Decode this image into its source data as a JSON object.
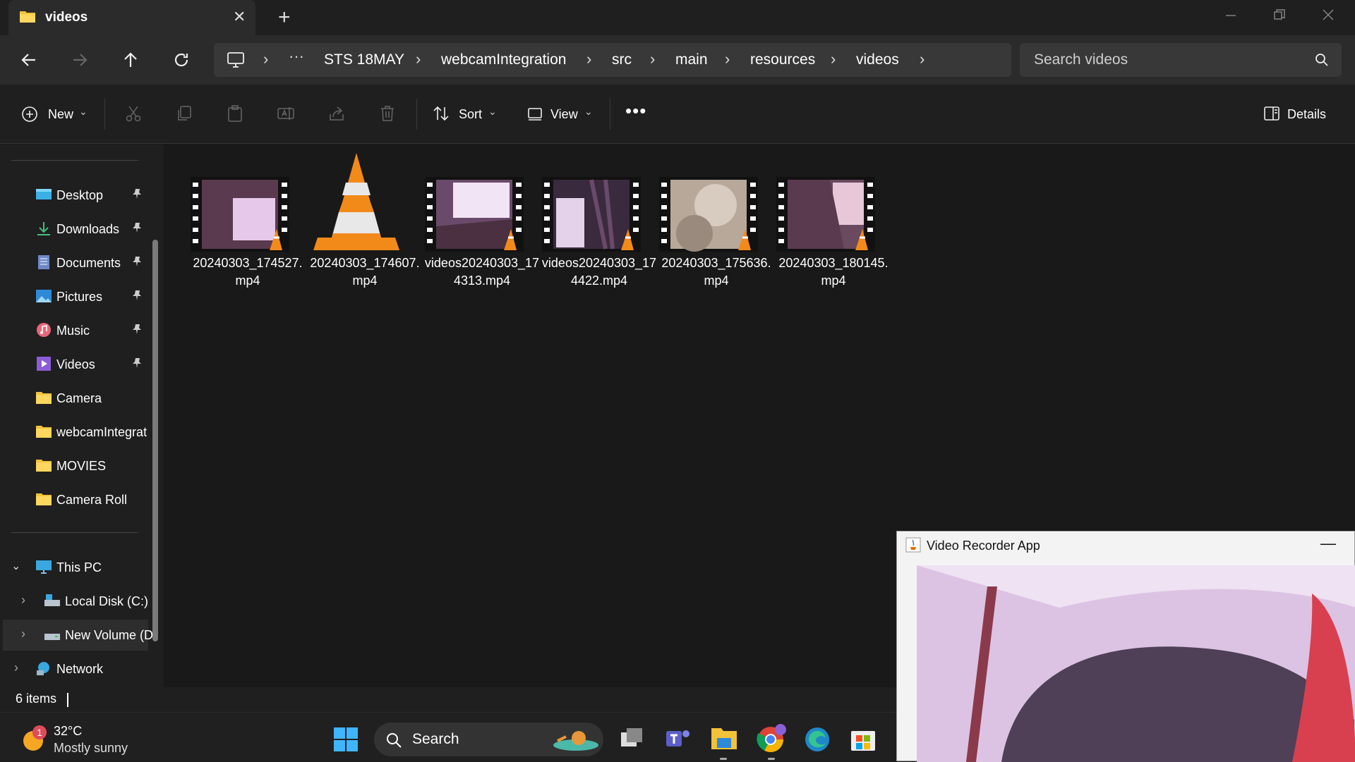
{
  "window": {
    "tab_title": "videos",
    "new_tab": "+",
    "close_tab": "✕"
  },
  "breadcrumb": [
    "STS 18MAY",
    "webcamIntegration",
    "src",
    "main",
    "resources",
    "videos"
  ],
  "search": {
    "placeholder": "Search videos"
  },
  "toolbar": {
    "new_label": "New",
    "sort_label": "Sort",
    "view_label": "View",
    "details_label": "Details"
  },
  "sidebar": {
    "quick_access": [
      {
        "label": "Desktop",
        "icon": "desktop-icon",
        "pinned": true
      },
      {
        "label": "Downloads",
        "icon": "downloads-icon",
        "pinned": true
      },
      {
        "label": "Documents",
        "icon": "documents-icon",
        "pinned": true
      },
      {
        "label": "Pictures",
        "icon": "pictures-icon",
        "pinned": true
      },
      {
        "label": "Music",
        "icon": "music-icon",
        "pinned": true
      },
      {
        "label": "Videos",
        "icon": "videos-icon",
        "pinned": true
      },
      {
        "label": "Camera",
        "icon": "folder-icon",
        "pinned": false
      },
      {
        "label": "webcamIntegrat",
        "icon": "folder-icon",
        "pinned": false
      },
      {
        "label": "MOVIES",
        "icon": "folder-icon",
        "pinned": false
      },
      {
        "label": "Camera Roll",
        "icon": "folder-icon",
        "pinned": false
      }
    ],
    "this_pc": "This PC",
    "drives": [
      "Local Disk (C:)",
      "New Volume (D"
    ],
    "network": "Network"
  },
  "files": [
    {
      "name": "20240303_174527.mp4",
      "thumb": "video-thumbnail"
    },
    {
      "name": "20240303_174607.mp4",
      "thumb": "vlc-cone-icon"
    },
    {
      "name": "videos20240303_174313.mp4",
      "thumb": "video-thumbnail"
    },
    {
      "name": "videos20240303_174422.mp4",
      "thumb": "video-thumbnail"
    },
    {
      "name": "20240303_175636.mp4",
      "thumb": "video-thumbnail"
    },
    {
      "name": "20240303_180145.mp4",
      "thumb": "video-thumbnail"
    }
  ],
  "status": {
    "items": "6 items"
  },
  "taskbar": {
    "weather_temp": "32°C",
    "weather_desc": "Mostly sunny",
    "weather_badge": "1",
    "search_label": "Search"
  },
  "recorder": {
    "title": "Video Recorder App",
    "minimize": "—"
  }
}
